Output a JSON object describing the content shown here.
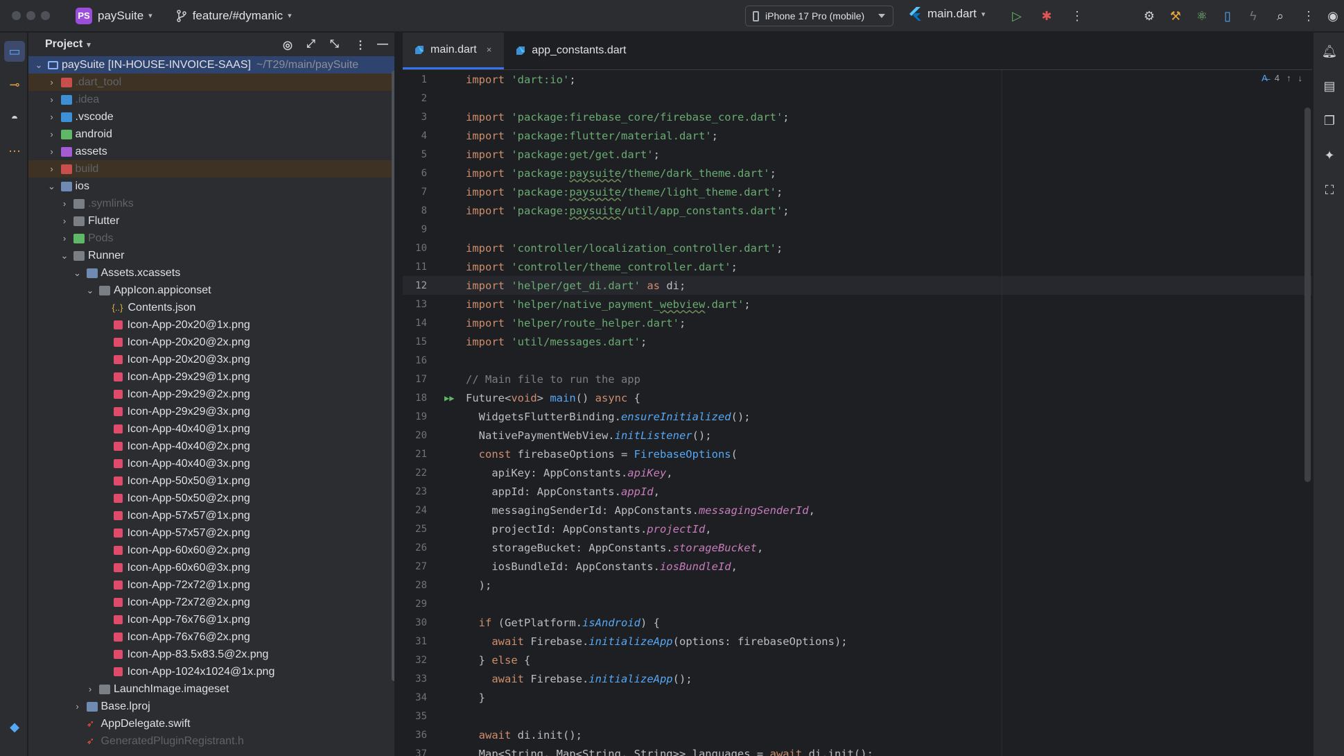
{
  "titlebar": {
    "project_badge": "PS",
    "project_name": "paySuite",
    "branch": "feature/#dymanic",
    "device": "iPhone 17 Pro (mobile)",
    "run_config": "main.dart"
  },
  "project_panel": {
    "title": "Project",
    "root_name": "paySuite [IN-HOUSE-INVOICE-SAAS]",
    "root_path": "~/T29/main/paySuite",
    "rows": [
      {
        "label": ".dart_tool",
        "depth": 1,
        "arrow": "›",
        "icon": "folder-red",
        "dim": true,
        "hl": true
      },
      {
        "label": ".idea",
        "depth": 1,
        "arrow": "›",
        "icon": "folder-blue",
        "dim": true,
        "hl": false
      },
      {
        "label": ".vscode",
        "depth": 1,
        "arrow": "›",
        "icon": "folder-blue",
        "dim": false,
        "hl": false
      },
      {
        "label": "android",
        "depth": 1,
        "arrow": "›",
        "icon": "folder-green",
        "dim": false,
        "hl": false
      },
      {
        "label": "assets",
        "depth": 1,
        "arrow": "›",
        "icon": "folder-purple",
        "dim": false,
        "hl": false
      },
      {
        "label": "build",
        "depth": 1,
        "arrow": "›",
        "icon": "folder-red",
        "dim": true,
        "hl": true
      },
      {
        "label": "ios",
        "depth": 1,
        "arrow": "⌄",
        "icon": "folder-ios",
        "dim": false,
        "hl": false
      },
      {
        "label": ".symlinks",
        "depth": 2,
        "arrow": "›",
        "icon": "folder",
        "dim": true,
        "hl": false
      },
      {
        "label": "Flutter",
        "depth": 2,
        "arrow": "›",
        "icon": "folder",
        "dim": false,
        "hl": false
      },
      {
        "label": "Pods",
        "depth": 2,
        "arrow": "›",
        "icon": "folder-green",
        "dim": true,
        "hl": false
      },
      {
        "label": "Runner",
        "depth": 2,
        "arrow": "⌄",
        "icon": "folder",
        "dim": false,
        "hl": false
      },
      {
        "label": "Assets.xcassets",
        "depth": 3,
        "arrow": "⌄",
        "icon": "folder-ios",
        "dim": false,
        "hl": false
      },
      {
        "label": "AppIcon.appiconset",
        "depth": 4,
        "arrow": "⌄",
        "icon": "folder",
        "dim": false,
        "hl": false
      },
      {
        "label": "Contents.json",
        "depth": 5,
        "arrow": "",
        "icon": "json",
        "dim": false,
        "hl": false
      },
      {
        "label": "Icon-App-20x20@1x.png",
        "depth": 5,
        "arrow": "",
        "icon": "img",
        "dim": false,
        "hl": false
      },
      {
        "label": "Icon-App-20x20@2x.png",
        "depth": 5,
        "arrow": "",
        "icon": "img",
        "dim": false,
        "hl": false
      },
      {
        "label": "Icon-App-20x20@3x.png",
        "depth": 5,
        "arrow": "",
        "icon": "img",
        "dim": false,
        "hl": false
      },
      {
        "label": "Icon-App-29x29@1x.png",
        "depth": 5,
        "arrow": "",
        "icon": "img",
        "dim": false,
        "hl": false
      },
      {
        "label": "Icon-App-29x29@2x.png",
        "depth": 5,
        "arrow": "",
        "icon": "img",
        "dim": false,
        "hl": false
      },
      {
        "label": "Icon-App-29x29@3x.png",
        "depth": 5,
        "arrow": "",
        "icon": "img",
        "dim": false,
        "hl": false
      },
      {
        "label": "Icon-App-40x40@1x.png",
        "depth": 5,
        "arrow": "",
        "icon": "img",
        "dim": false,
        "hl": false
      },
      {
        "label": "Icon-App-40x40@2x.png",
        "depth": 5,
        "arrow": "",
        "icon": "img",
        "dim": false,
        "hl": false
      },
      {
        "label": "Icon-App-40x40@3x.png",
        "depth": 5,
        "arrow": "",
        "icon": "img",
        "dim": false,
        "hl": false
      },
      {
        "label": "Icon-App-50x50@1x.png",
        "depth": 5,
        "arrow": "",
        "icon": "img",
        "dim": false,
        "hl": false
      },
      {
        "label": "Icon-App-50x50@2x.png",
        "depth": 5,
        "arrow": "",
        "icon": "img",
        "dim": false,
        "hl": false
      },
      {
        "label": "Icon-App-57x57@1x.png",
        "depth": 5,
        "arrow": "",
        "icon": "img",
        "dim": false,
        "hl": false
      },
      {
        "label": "Icon-App-57x57@2x.png",
        "depth": 5,
        "arrow": "",
        "icon": "img",
        "dim": false,
        "hl": false
      },
      {
        "label": "Icon-App-60x60@2x.png",
        "depth": 5,
        "arrow": "",
        "icon": "img",
        "dim": false,
        "hl": false
      },
      {
        "label": "Icon-App-60x60@3x.png",
        "depth": 5,
        "arrow": "",
        "icon": "img",
        "dim": false,
        "hl": false
      },
      {
        "label": "Icon-App-72x72@1x.png",
        "depth": 5,
        "arrow": "",
        "icon": "img",
        "dim": false,
        "hl": false
      },
      {
        "label": "Icon-App-72x72@2x.png",
        "depth": 5,
        "arrow": "",
        "icon": "img",
        "dim": false,
        "hl": false
      },
      {
        "label": "Icon-App-76x76@1x.png",
        "depth": 5,
        "arrow": "",
        "icon": "img",
        "dim": false,
        "hl": false
      },
      {
        "label": "Icon-App-76x76@2x.png",
        "depth": 5,
        "arrow": "",
        "icon": "img",
        "dim": false,
        "hl": false
      },
      {
        "label": "Icon-App-83.5x83.5@2x.png",
        "depth": 5,
        "arrow": "",
        "icon": "img",
        "dim": false,
        "hl": false
      },
      {
        "label": "Icon-App-1024x1024@1x.png",
        "depth": 5,
        "arrow": "",
        "icon": "img",
        "dim": false,
        "hl": false
      },
      {
        "label": "LaunchImage.imageset",
        "depth": 4,
        "arrow": "›",
        "icon": "folder",
        "dim": false,
        "hl": false
      },
      {
        "label": "Base.lproj",
        "depth": 3,
        "arrow": "›",
        "icon": "folder-ios",
        "dim": false,
        "hl": false
      },
      {
        "label": "AppDelegate.swift",
        "depth": 3,
        "arrow": "",
        "icon": "swift",
        "dim": false,
        "hl": false
      },
      {
        "label": "GeneratedPluginRegistrant.h",
        "depth": 3,
        "arrow": "",
        "icon": "swift",
        "dim": true,
        "hl": false
      }
    ]
  },
  "editor": {
    "tabs": [
      {
        "label": "main.dart",
        "active": true,
        "close": "×"
      },
      {
        "label": "app_constants.dart",
        "active": false,
        "close": ""
      }
    ],
    "inspection_count": "4",
    "current_line": 12,
    "lines": [
      "import 'dart:io';",
      "",
      "import 'package:firebase_core/firebase_core.dart';",
      "import 'package:flutter/material.dart';",
      "import 'package:get/get.dart';",
      "import 'package:paysuite/theme/dark_theme.dart';",
      "import 'package:paysuite/theme/light_theme.dart';",
      "import 'package:paysuite/util/app_constants.dart';",
      "",
      "import 'controller/localization_controller.dart';",
      "import 'controller/theme_controller.dart';",
      "import 'helper/get_di.dart' as di;",
      "import 'helper/native_payment_webview.dart';",
      "import 'helper/route_helper.dart';",
      "import 'util/messages.dart';",
      "",
      "// Main file to run the app",
      "Future<void> main() async {",
      "  WidgetsFlutterBinding.ensureInitialized();",
      "  NativePaymentWebView.initListener();",
      "  const firebaseOptions = FirebaseOptions(",
      "    apiKey: AppConstants.apiKey,",
      "    appId: AppConstants.appId,",
      "    messagingSenderId: AppConstants.messagingSenderId,",
      "    projectId: AppConstants.projectId,",
      "    storageBucket: AppConstants.storageBucket,",
      "    iosBundleId: AppConstants.iosBundleId,",
      "  );",
      "",
      "  if (GetPlatform.isAndroid) {",
      "    await Firebase.initializeApp(options: firebaseOptions);",
      "  } else {",
      "    await Firebase.initializeApp();",
      "  }",
      "",
      "  await di.init();",
      "  Map<String, Map<String, String>> languages = await di.init();"
    ]
  }
}
